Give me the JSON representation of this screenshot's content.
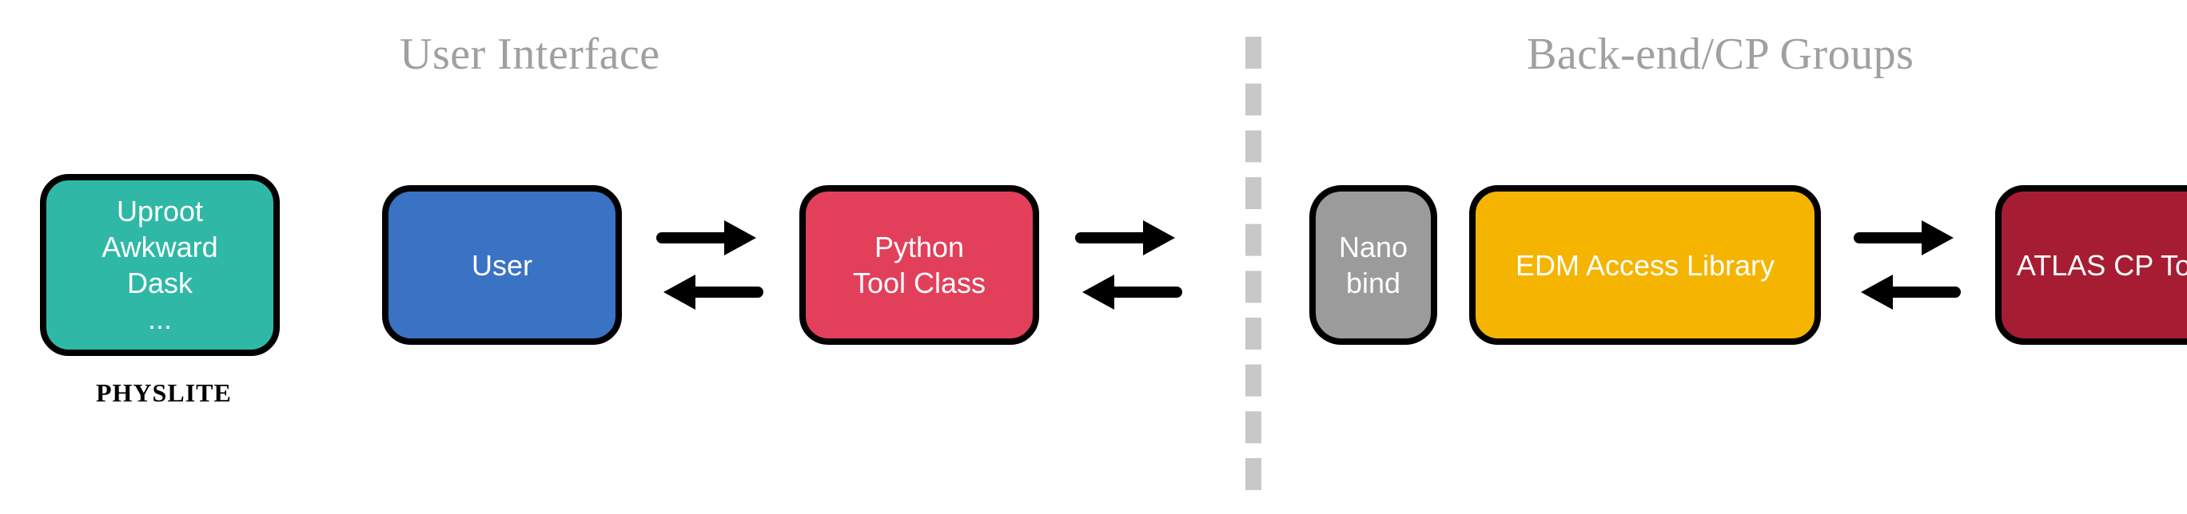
{
  "sections": {
    "left_title": "User Interface",
    "right_title": "Back-end/CP Groups"
  },
  "boxes": {
    "physlite": {
      "lines": [
        "Uproot",
        "Awkward",
        "Dask",
        "..."
      ],
      "caption": "PHYSLITE",
      "color": "#2fb8a6"
    },
    "user": {
      "label": "User",
      "color": "#3a72c4"
    },
    "python_tool": {
      "lines": [
        "Python",
        "Tool Class"
      ],
      "color": "#e23f5b"
    },
    "nanobind": {
      "lines": [
        "Nano",
        "bind"
      ],
      "color": "#9b9b9b"
    },
    "edm": {
      "label": "EDM Access Library",
      "color": "#f5b400"
    },
    "atlas": {
      "label": "ATLAS CP Tool",
      "color": "#a61d33"
    }
  }
}
